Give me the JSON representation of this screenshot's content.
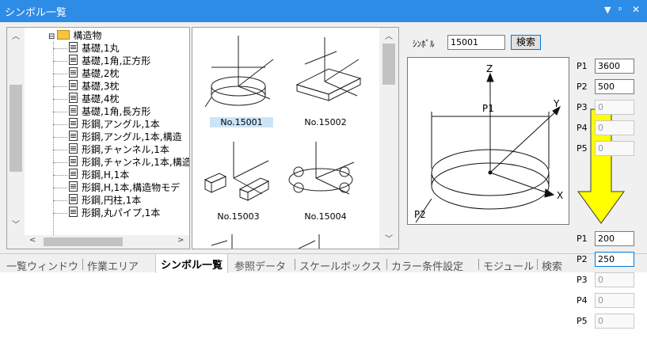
{
  "window": {
    "title": "シンボル一覧",
    "controls": [
      "▼",
      "ᵖ",
      "✕"
    ]
  },
  "tree": {
    "root_label": "構造物",
    "items": [
      "基礎,1丸",
      "基礎,1角,正方形",
      "基礎,2枕",
      "基礎,3枕",
      "基礎,4枕",
      "基礎,1角,長方形",
      "形鋼,アングル,1本",
      "形鋼,アングル,1本,構造",
      "形鋼,チャンネル,1本",
      "形鋼,チャンネル,1本,構造",
      "形鋼,H,1本",
      "形鋼,H,1本,構造物モデ",
      "形鋼,円柱,1本",
      "形鋼,丸パイプ,1本"
    ]
  },
  "gallery": {
    "items": [
      "No.15001",
      "No.15002",
      "No.15003",
      "No.15004"
    ],
    "selected": "No.15001"
  },
  "symbol": {
    "label": "ｼﾝﾎﾞﾙ",
    "value": "15001",
    "search_button": "検索"
  },
  "params_top": [
    {
      "label": "P1",
      "value": "3600",
      "enabled": true
    },
    {
      "label": "P2",
      "value": "500",
      "enabled": true
    },
    {
      "label": "P3",
      "value": "0",
      "enabled": false
    },
    {
      "label": "P4",
      "value": "0",
      "enabled": false
    },
    {
      "label": "P5",
      "value": "0",
      "enabled": false
    }
  ],
  "params_bottom": [
    {
      "label": "P1",
      "value": "200",
      "enabled": true
    },
    {
      "label": "P2",
      "value": "250",
      "enabled": true
    },
    {
      "label": "P3",
      "value": "0",
      "enabled": false
    },
    {
      "label": "P4",
      "value": "0",
      "enabled": false
    },
    {
      "label": "P5",
      "value": "0",
      "enabled": false
    }
  ],
  "preview": {
    "z": "Z",
    "y": "Y",
    "x": "X",
    "p1": "P1",
    "p2": "P2"
  },
  "tabs": [
    "一覧ウィンドウ",
    "作業エリア",
    "シンボル一覧",
    "参照データ",
    "スケールボックス",
    "カラー条件設定",
    "モジュール",
    "検索"
  ],
  "active_tab": "シンボル一覧",
  "colors": {
    "titlebar": "#2d8ce6",
    "arrow": "#ffff00",
    "focus": "#0078d7"
  }
}
